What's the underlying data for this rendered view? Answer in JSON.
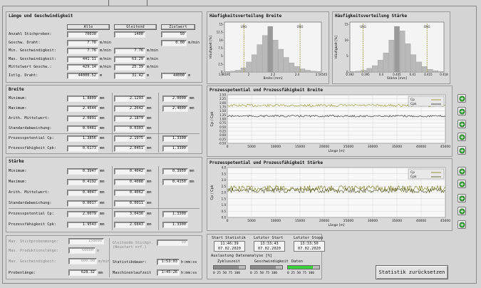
{
  "speed": {
    "title": "Länge und Geschwindigkeit",
    "col_all": "Alle",
    "col_sliding": "Gleitend",
    "col_target": "Zielwert",
    "rows": [
      {
        "label": "Anzahl Stichproben:",
        "all": "70030",
        "all_unit": "",
        "sliding": "1400",
        "sliding_unit": "",
        "target": "50",
        "target_unit": ""
      },
      {
        "label": "Geschw. Draht:",
        "all": "7.76",
        "all_unit": "m/min",
        "sliding": "",
        "sliding_unit": "",
        "target": "0.00",
        "target_unit": "m/min"
      },
      {
        "label": "Min. Geschwindigkeit:",
        "all": "7.76",
        "all_unit": "m/min",
        "sliding": "7.76",
        "sliding_unit": "m/min",
        "target": "",
        "target_unit": ""
      },
      {
        "label": "Max. Geschwindigkeit:",
        "all": "441.11",
        "all_unit": "m/min",
        "sliding": "63.29",
        "sliding_unit": "m/min",
        "target": "",
        "target_unit": ""
      },
      {
        "label": "Mittelwert Geschw.:",
        "all": "429.14",
        "all_unit": "m/min",
        "sliding": "25.39",
        "sliding_unit": "m/min",
        "target": "",
        "target_unit": ""
      },
      {
        "label": "Istlg. Draht:",
        "all": "44000.52",
        "all_unit": "m",
        "sliding": "31.42",
        "sliding_unit": "m",
        "target": "44000",
        "target_unit": "m"
      }
    ]
  },
  "breite": {
    "title": "Breite",
    "rows": [
      {
        "label": "Minimum:",
        "all": "1.8809",
        "sliding": "2.1293",
        "target": "2.0000"
      },
      {
        "label": "Maximum:",
        "all": "2.4544",
        "sliding": "2.2642",
        "target": "2.4000"
      },
      {
        "label": "Arith. Mittelwert:",
        "all": "2.0891",
        "sliding": "2.1879",
        "target": ""
      },
      {
        "label": "Standardabweichung:",
        "all": "0.0481",
        "sliding": "0.0303",
        "target": ""
      },
      {
        "label": "Prozesspotential Cp:",
        "all": "1.3856",
        "sliding": "2.1975",
        "target": "1.3300"
      },
      {
        "label": "Prozessfähigkeit Cpk:",
        "all": "0.6173",
        "sliding": "2.0451",
        "target": "1.3300"
      }
    ]
  },
  "staerke": {
    "title": "Stärke",
    "rows": [
      {
        "label": "Minimum:",
        "all": "0.3947",
        "sliding": "0.4042",
        "target": "0.3950"
      },
      {
        "label": "Maximum:",
        "all": "0.4192",
        "sliding": "0.4088",
        "target": "0.4150"
      },
      {
        "label": "Arith. Mittelwert:",
        "all": "0.4047",
        "sliding": "0.4062",
        "target": ""
      },
      {
        "label": "Standardabweichung:",
        "all": "0.0017",
        "sliding": "0.0011",
        "target": ""
      },
      {
        "label": "Prozesspotential Cp:",
        "all": "2.0079",
        "sliding": "3.0436",
        "target": "1.3300"
      },
      {
        "label": "Prozessfähigkeit Cpk:",
        "all": "1.9543",
        "sliding": "2.6843",
        "target": "1.3300"
      }
    ]
  },
  "unit_mm": "mm",
  "bottom": {
    "max_samples_label": "Max. Stichprobenmenge:",
    "max_samples": "150000",
    "max_len_label": "Max. Produktionslänge:",
    "max_len": "60000",
    "max_len_unit": "m",
    "max_speed_label": "Max. Geschwindigkeit:",
    "max_speed": "600.00",
    "max_speed_unit": "m/min",
    "sample_len_label": "Probenlänge:",
    "sample_len": "628.32",
    "sample_len_unit": "mm",
    "sliding_label": "Gleitende Stichpr.",
    "sliding_label2": "(Neustart erf.)",
    "sliding_val": "50",
    "stat_dur_label": "Statistikdauer:",
    "stat_dur": "1:53:03",
    "stat_dur_unit": "h:mm:ss",
    "machine_label": "Maschinenlaufzeit",
    "machine": "1:45:26",
    "machine_unit": "h:mm:ss"
  },
  "status": {
    "start_label": "Start Statistik",
    "start_time": "11:46:39",
    "start_date": "07.02.2020",
    "last_start_label": "Letzter Start",
    "last_start_time": "13:33:43",
    "last_start_date": "07.02.2020",
    "last_stop_label": "Letzter Stopp",
    "last_stop_time": "13:33:50",
    "last_stop_date": "07.02.2020",
    "load_label": "Auslastung Datenanalyse [%]",
    "gauges": [
      {
        "label": "Zykluszeit",
        "value": 80,
        "color": "#8a8a8a"
      },
      {
        "label": "Geschwindigkeit",
        "value": 80,
        "color": "#8a8a8a"
      },
      {
        "label": "Daten",
        "value": 80,
        "color": "#3cd13c"
      }
    ],
    "gauge_scale": "0  25  50  75  100"
  },
  "reset_button": "Statistik zurücksetzen",
  "hist_breite": {
    "title": "Häufigkeitsverteilung Breite",
    "xlabel": "Breite [mm]",
    "ylabel": "Häufigkeit [%]",
    "yticks": [
      "15-",
      "12.5-",
      "10-",
      "7.5-",
      "5-",
      "2.5-",
      "0-"
    ],
    "xticks": [
      "1.86195",
      "2",
      "2.2",
      "2.4",
      "2.54545"
    ],
    "markers": [
      "USG",
      "OSG"
    ]
  },
  "hist_staerke": {
    "title": "Häufigkeitsverteilung Stärke",
    "xlabel": "Stärke [mm]",
    "ylabel": "Häufigkeit [%]",
    "yticks": [
      "15-",
      "10-",
      "5-",
      "0-"
    ],
    "xticks": [
      "0.392",
      "0.395",
      "0.4",
      "0.405",
      "0.41",
      "0.415",
      "0.418"
    ],
    "markers": [
      "USG",
      "OSG"
    ]
  },
  "chart_breite": {
    "title": "Prozesspotential und Prozessfähigkeit Breite",
    "xlabel": "Länge [m]",
    "ylabel": "Cp / Cpk",
    "yticks": [
      "2.50",
      "2.25",
      "2.00",
      "1.75",
      "1.50",
      "1.25",
      "1.00",
      "0.75",
      "0.50",
      "0.25",
      "0.00",
      "-0.25",
      "-0.50"
    ],
    "xticks": [
      "0",
      "5000",
      "10000",
      "15000",
      "20000",
      "25000",
      "30000",
      "35000",
      "40000",
      "45000"
    ],
    "legend": [
      "Cp",
      "Cpk"
    ]
  },
  "chart_staerke": {
    "title": "Prozesspotential und Prozessfähigkeit Stärke",
    "xlabel": "Länge [m]",
    "ylabel": "Cp / Cpk",
    "yticks": [
      "4.0",
      "3.5",
      "3.0",
      "2.5",
      "2.0",
      "1.5",
      "1.0",
      "0.5",
      "0.0"
    ],
    "xticks": [
      "0",
      "5000",
      "10000",
      "15000",
      "20000",
      "25000",
      "30000",
      "35000",
      "40000",
      "45000"
    ],
    "legend": [
      "Cp",
      "Cpk"
    ]
  }
}
